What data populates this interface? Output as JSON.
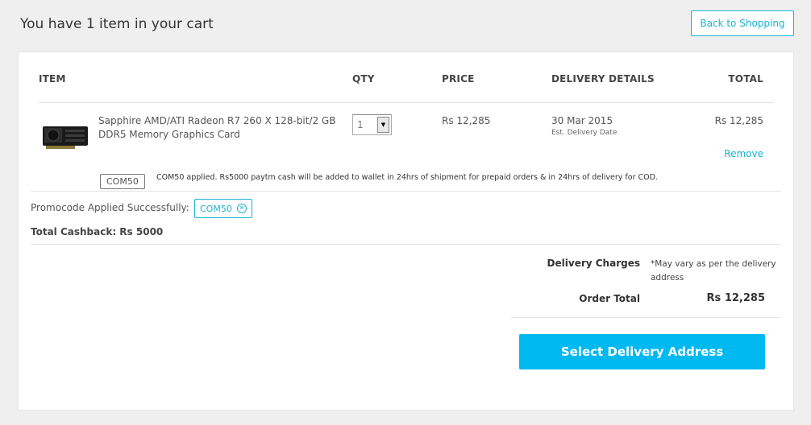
{
  "header": {
    "title": "You have 1 item in your cart",
    "back_label": "Back to Shopping"
  },
  "table": {
    "columns": [
      "ITEM",
      "QTY",
      "PRICE",
      "DELIVERY DETAILS",
      "TOTAL"
    ],
    "rows": [
      {
        "name": "Sapphire AMD/ATI Radeon R7 260 X 128-bit/2 GB DDR5 Memory Graphics Card",
        "qty": "1",
        "price": "Rs 12,285",
        "delivery_date": "30 Mar 2015",
        "delivery_note": "Est. Delivery Date",
        "total": "Rs 12,285",
        "remove_label": "Remove",
        "code": "COM50",
        "code_message": "COM50 applied. Rs5000 paytm cash will be added to wallet in 24hrs of shipment for prepaid orders & in 24hrs of delivery for COD."
      }
    ]
  },
  "promo": {
    "label": "Promocode Applied Successfully:",
    "code": "COM50",
    "cashback": "Total Cashback: Rs 5000"
  },
  "summary": {
    "delivery_label": "Delivery Charges",
    "delivery_note": "*May vary as per the delivery address",
    "order_total_label": "Order Total",
    "order_total_value": "Rs 12,285"
  },
  "cta": {
    "label": "Select Delivery Address"
  },
  "colors": {
    "accent": "#1ab3d3",
    "cta": "#00b9f0"
  }
}
